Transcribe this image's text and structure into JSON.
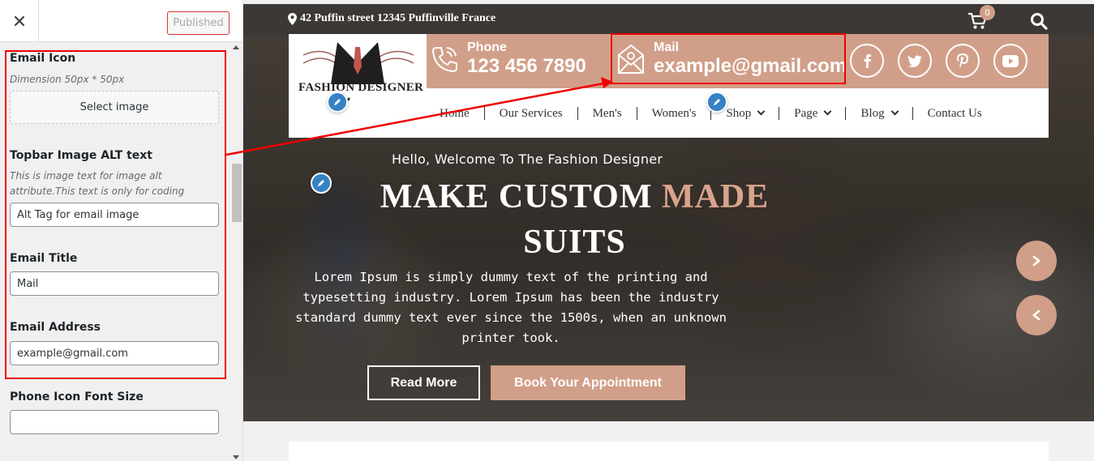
{
  "sidebar": {
    "publish_label": "Published",
    "controls": {
      "email_icon_label": "Email Icon",
      "email_icon_desc": "Dimension 50px * 50px",
      "select_image_label": "Select image",
      "alt_label": "Topbar Image ALT text",
      "alt_desc": "This is image text for image alt attribute.This text is only for coding purpose.",
      "alt_value": "Alt Tag for email image",
      "email_title_label": "Email Title",
      "email_title_value": "Mail",
      "email_address_label": "Email Address",
      "email_address_value": "example@gmail.com",
      "phone_icon_size_label": "Phone Icon Font Size",
      "phone_icon_size_value": ""
    }
  },
  "preview": {
    "address": "42 Puffin street 12345 Puffinville France",
    "cart_count": "0",
    "logo_text": "FASHION DESIGNER",
    "phone_title": "Phone",
    "phone_value": "123 456 7890",
    "mail_title": "Mail",
    "mail_value": "example@gmail.com",
    "social": [
      "f",
      "t",
      "p",
      "y"
    ],
    "nav": [
      "Home",
      "Our Services",
      "Men's",
      "Women's",
      "Shop",
      "Page",
      "Blog",
      "Contact Us"
    ],
    "hero": {
      "welcome": "Hello, Welcome To The Fashion Designer",
      "headline_1": "MAKE CUSTOM ",
      "headline_accent": "MADE",
      "headline_2": "SUITS",
      "description": "Lorem Ipsum is simply dummy text of the printing and typesetting industry. Lorem Ipsum has been the industry standard dummy text ever since the 1500s, when an unknown printer took.",
      "read_more": "Read More",
      "book": "Book Your Appointment"
    }
  },
  "colors": {
    "accent": "#d19f89",
    "topbar": "#3b3835",
    "highlight": "#ee0000",
    "edit_blue": "#3582c4"
  }
}
